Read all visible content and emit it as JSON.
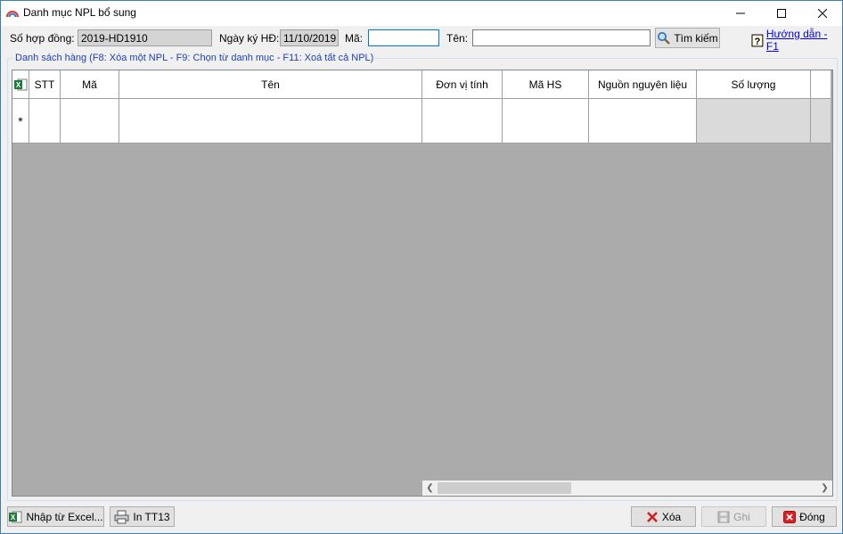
{
  "window": {
    "title": "Danh mục NPL bổ sung",
    "min_glyph": "—",
    "max_glyph": "☐",
    "close_glyph": "✕"
  },
  "form": {
    "contract_label": "Số hợp đồng:",
    "contract_value": "2019-HD1910",
    "sign_date_label": "Ngày ký HĐ:",
    "sign_date_value": "11/10/2019",
    "code_label": "Mã:",
    "code_value": "",
    "name_label": "Tên:",
    "name_value": "",
    "search_button": "Tìm kiếm",
    "help_link": "Hướng dẫn - F1"
  },
  "group": {
    "legend": "Danh sách hàng (F8: Xóa một NPL - F9: Chọn từ danh mục - F11: Xoá tất cả NPL)"
  },
  "grid": {
    "columns": [
      "STT",
      "Mã",
      "Tên",
      "Đơn vị tính",
      "Mã HS",
      "Nguồn nguyên liệu",
      "Số lượng"
    ],
    "new_row_marker": "*"
  },
  "footer": {
    "import_excel": "Nhập từ Excel...",
    "print": "In TT13",
    "delete": "Xóa",
    "save": "Ghi",
    "close": "Đóng"
  },
  "colors": {
    "accent_link": "#0000ee",
    "legend_text": "#1f3fb5",
    "delete_icon": "#d02020",
    "close_icon": "#e02020",
    "excel_icon": "#1d7a3c"
  },
  "icons": {
    "app": "rainbow-arc-icon",
    "search": "magnifier-icon",
    "help": "question-box-icon",
    "excel": "excel-icon",
    "print": "printer-icon",
    "delete": "red-x-icon",
    "save": "floppy-icon",
    "close": "close-box-icon"
  }
}
